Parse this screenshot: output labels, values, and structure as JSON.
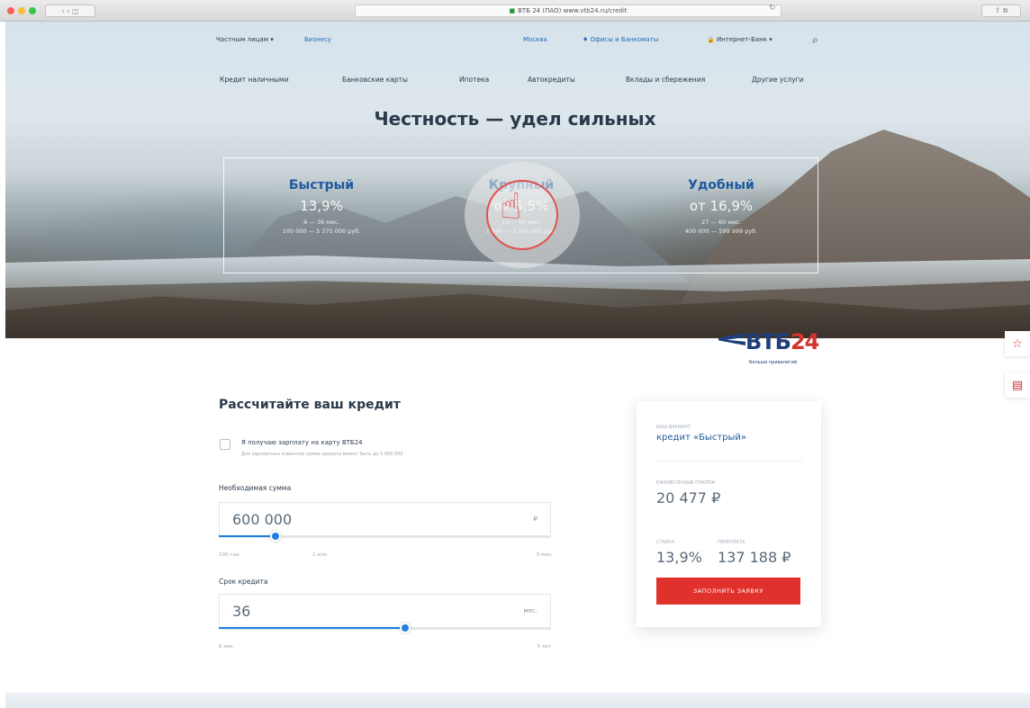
{
  "browser": {
    "nav_buttons": "‹  ›  ◫",
    "url": "ВТБ 24 (ПАО) www.vtb24.ru/credit",
    "reload": "↻",
    "right_buttons": "⇪  ⧉"
  },
  "topnav": {
    "private": "Частным лицам ▾",
    "business": "Бизнесу",
    "city": "Москва",
    "offices": "♦ Офисы и Банкоматы",
    "internet_bank": "🔒 Интернет-Банк ▾",
    "search_icon": "⌕"
  },
  "mainnav": {
    "items": [
      "Кредит наличными",
      "Банковские карты",
      "Ипотека",
      "Автокредиты",
      "Вклады и сбережения",
      "Другие услуги"
    ]
  },
  "hero": {
    "title": "Честность — удел сильных"
  },
  "offers": [
    {
      "name": "Быстрый",
      "rate": "13,9%",
      "term": "6 — 36 мес.",
      "sum": "100 000 — 5 375 000 руб."
    },
    {
      "name": "Крупный",
      "rate": "от 5,5%",
      "term": "13 — 60 мес.",
      "sum": "1 000 — 3 000 000 руб."
    },
    {
      "name": "Удобный",
      "rate": "от 16,9%",
      "term": "27 — 60 мес.",
      "sum": "400 000 — 599 999 руб."
    }
  ],
  "logo": {
    "text": "ВТБ",
    "num": "24",
    "tagline": "Больше привилегий"
  },
  "calculator": {
    "title": "Рассчитайте ваш кредит",
    "checkbox_label": "Я получаю зарплату на карту ВТБ24",
    "checkbox_note": "Для зарплатных клиентов сумма кредита может быть до 5 000 000",
    "amount_label": "Необходимая сумма",
    "amount_value": "600 000",
    "amount_unit": "₽",
    "amount_scale": [
      "100 тыс.",
      "1 млн",
      "3 млн"
    ],
    "amount_fill": 0.17,
    "term_label": "Срок кредита",
    "term_value": "36",
    "term_unit": "мес.",
    "term_scale": [
      "6 мес.",
      "5 лет"
    ],
    "term_fill": 0.56
  },
  "result": {
    "product_caption": "ВАШ ВАРИАНТ",
    "product": "кредит «Быстрый»",
    "payment_caption": "ЕЖЕМЕСЯЧНЫЙ ПЛАТЁЖ",
    "payment": "20 477 ₽",
    "rate_caption": "СТАВКА",
    "rate": "13,9%",
    "overpay_caption": "ПЕРЕПЛАТА",
    "overpay": "137 188 ₽",
    "apply_button": "ЗАПОЛНИТЬ ЗАЯВКУ"
  },
  "side_icons": {
    "favorite": "☆",
    "message": "▤"
  }
}
